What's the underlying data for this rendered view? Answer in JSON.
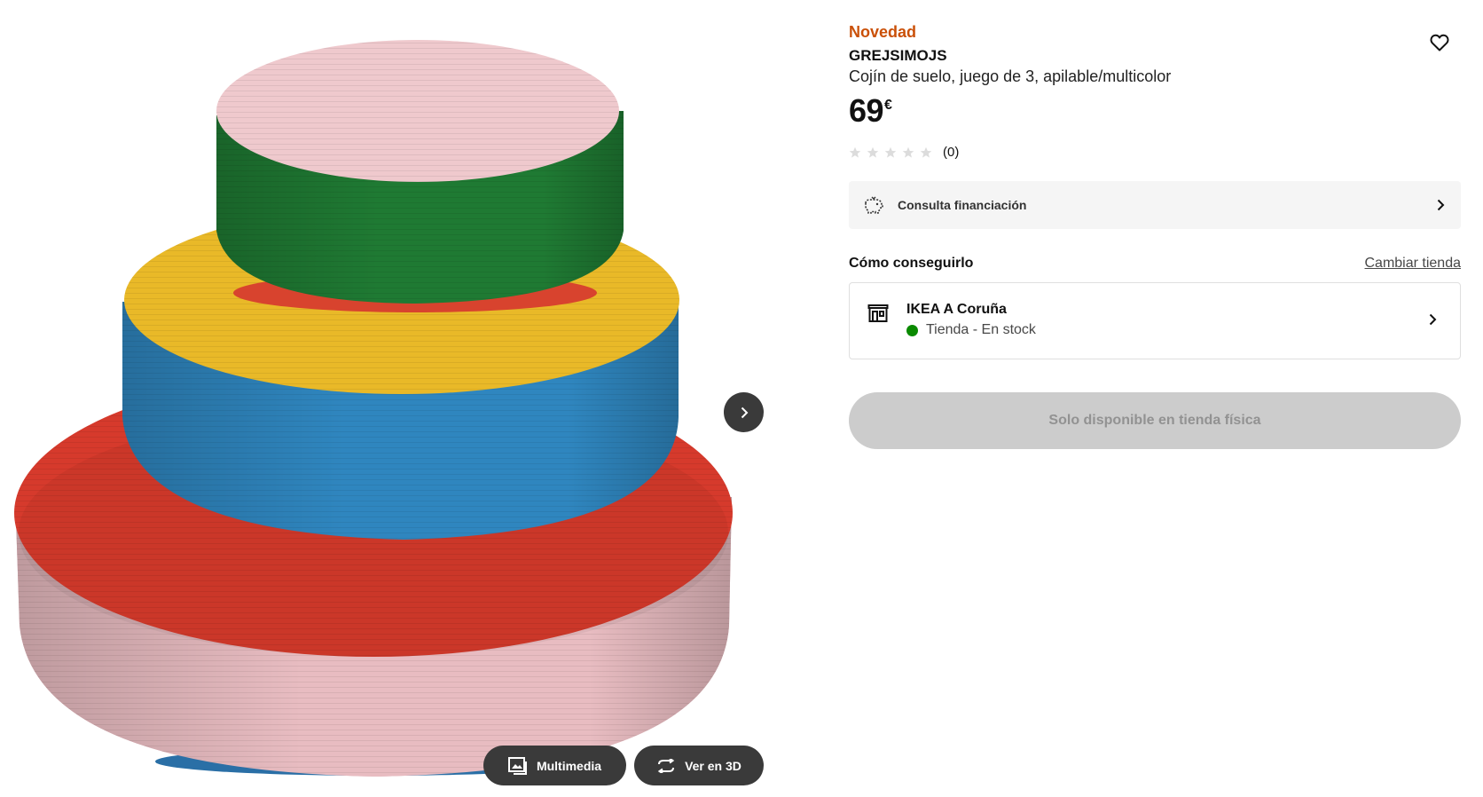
{
  "gallery": {
    "image_alt": "GREJSIMOJS cojines apilados",
    "multimedia_label": "Multimedia",
    "view3d_label": "Ver en 3D",
    "next_icon": "chevron-right-icon"
  },
  "product": {
    "badge": "Novedad",
    "name": "GREJSIMOJS",
    "description": "Cojín de suelo, juego de 3, apilable/multicolor",
    "price_amount": "69",
    "price_currency": "€",
    "rating_stars": 0,
    "rating_count": "(0)"
  },
  "financing": {
    "label": "Consulta financiación"
  },
  "availability": {
    "title": "Cómo conseguirlo",
    "change_store": "Cambiar tienda",
    "store_name": "IKEA A Coruña",
    "stock_status": "Tienda - En stock"
  },
  "cta": {
    "label": "Solo disponible en tienda física"
  },
  "colors": {
    "badge": "#ca5008",
    "in_stock": "#0a8a00",
    "disabled_button": "#cccccc",
    "dark_button": "#3a3a3a"
  }
}
